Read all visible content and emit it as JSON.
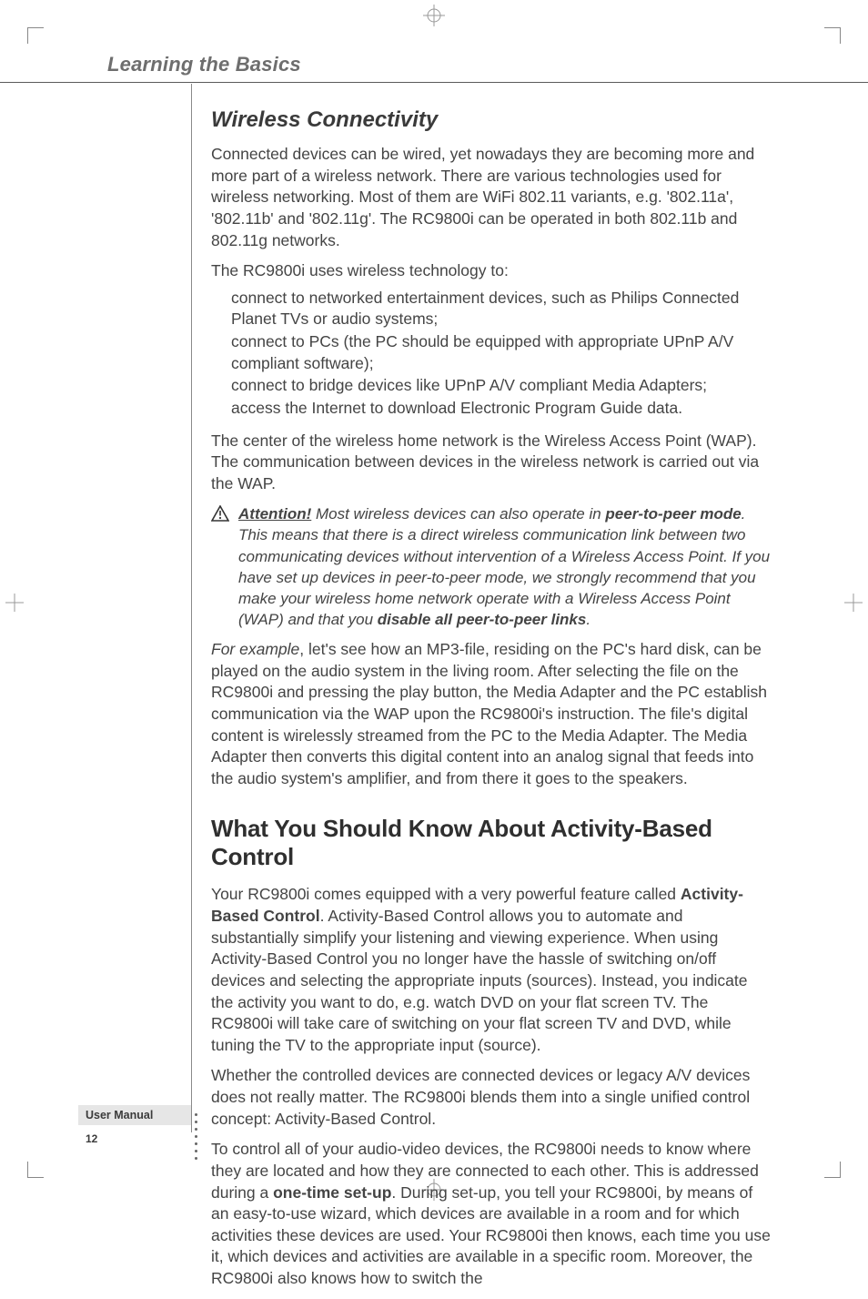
{
  "header": {
    "chapter_title": "Learning the Basics"
  },
  "section1": {
    "heading": "Wireless Connectivity",
    "p1": "Connected devices can be wired, yet nowadays they are becoming more and more part of a wireless network. There are various technologies used for wireless networking. Most of them are WiFi 802.11 variants, e.g. '802.11a', '802.11b' and '802.11g'. The RC9800i can be operated in both 802.11b and 802.11g networks.",
    "p2": "The RC9800i uses wireless technology to:",
    "bullets": [
      "connect to networked entertainment devices, such as Philips Connected Planet TVs or audio systems;",
      "connect to PCs (the PC should be equipped with appropriate UPnP A/V compliant software);",
      "connect to bridge devices like UPnP A/V compliant Media Adapters;",
      "access the Internet to download Electronic Program Guide data."
    ],
    "p3": "The center of the wireless home network is the Wireless Access Point (WAP). The communication between devices in the wireless network is carried out via the WAP.",
    "notice": {
      "label": "Attention!",
      "text_a": " Most wireless devices can also operate in ",
      "peer_mode": "peer-to-peer mode",
      "text_b": ". This means that there is a direct wireless communication link between two communicating devices without intervention of a Wireless Access Point. If you have set up devices in peer-to-peer mode, we strongly recommend that you make your wireless home network operate with a Wireless Access Point (WAP) and that you ",
      "disable": "disable all peer-to-peer links",
      "text_c": "."
    },
    "p4_lead": "For example",
    "p4_rest": ", let's see how an MP3-file, residing on the PC's hard disk, can be played on the audio system in the living room. After selecting the file on the RC9800i and pressing the play button, the Media Adapter and the PC establish communication via the WAP upon the RC9800i's instruction. The file's digital content is wirelessly streamed from the PC to the Media Adapter. The Media Adapter then converts this digital content into an analog signal that feeds into the audio system's amplifier, and from there it goes to the speakers."
  },
  "section2": {
    "heading": "What You Should Know About Activity-Based Control",
    "p1_a": "Your RC9800i comes equipped with a very powerful feature called ",
    "p1_b1": "Activity-Based Control",
    "p1_c": ". Activity-Based Control allows you to automate and substantially simplify your listening and viewing experience. When using Activity-Based Control you no longer have the hassle of switching on/off devices and selecting the appropriate inputs (sources). Instead, you indicate the activity you want to do, e.g. watch DVD on your flat screen TV. The RC9800i will take care of switching on your flat screen TV and DVD, while tuning the TV to the appropriate input (source).",
    "p2": "Whether the controlled devices are connected devices or legacy A/V devices does not really matter. The RC9800i blends them into a single unified control concept: Activity-Based Control.",
    "p3_a": "To control all of your audio-video devices, the RC9800i needs to know where they are located and how they are connected to each other. This is addressed during a ",
    "p3_b1": "one-time set-up",
    "p3_c": ". During set-up, you tell your RC9800i, by means of an easy-to-use wizard, which devices are available in a room and for which activities these devices are used. Your RC9800i then knows, each time you use it, which devices and activities are available in a specific room. Moreover, the RC9800i also knows how to switch the"
  },
  "footer": {
    "label": "User Manual",
    "page": "12"
  }
}
